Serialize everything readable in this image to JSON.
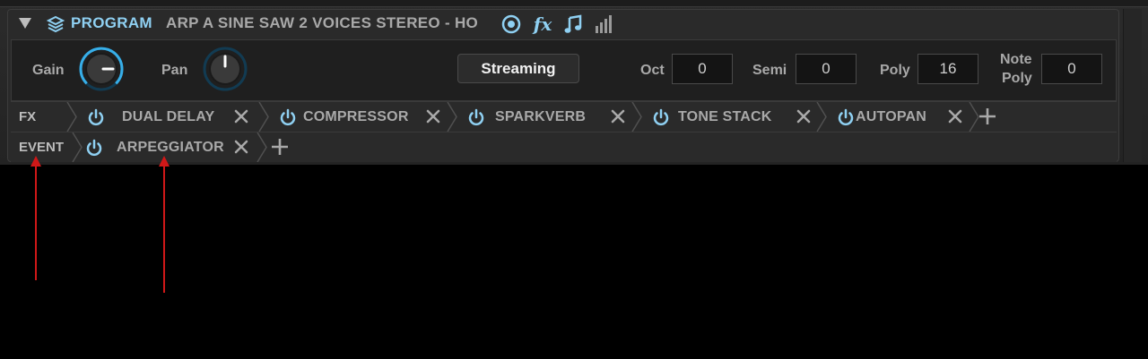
{
  "header": {
    "section_title": "PROGRAM",
    "preset_name": "ARP A SINE SAW 2 VOICES STEREO - HO",
    "icons": [
      "target-icon",
      "fx-icon",
      "music-note-icon",
      "bar-meter-icon"
    ],
    "fx_label": "fx",
    "accent_color": "#8fd0f2"
  },
  "controls": {
    "gain_label": "Gain",
    "pan_label": "Pan",
    "streaming_label": "Streaming",
    "oct_label": "Oct",
    "oct_value": "0",
    "semi_label": "Semi",
    "semi_value": "0",
    "poly_label": "Poly",
    "poly_value": "16",
    "note_poly_label_1": "Note",
    "note_poly_label_2": "Poly",
    "note_poly_value": "0"
  },
  "fx_row": {
    "label": "FX",
    "slots": [
      "DUAL DELAY",
      "COMPRESSOR",
      "SPARKVERB",
      "TONE STACK",
      "AUTOPAN"
    ]
  },
  "event_row": {
    "label": "EVENT",
    "slots": [
      "ARPEGGIATOR"
    ]
  },
  "annotation_color": "#d01818"
}
